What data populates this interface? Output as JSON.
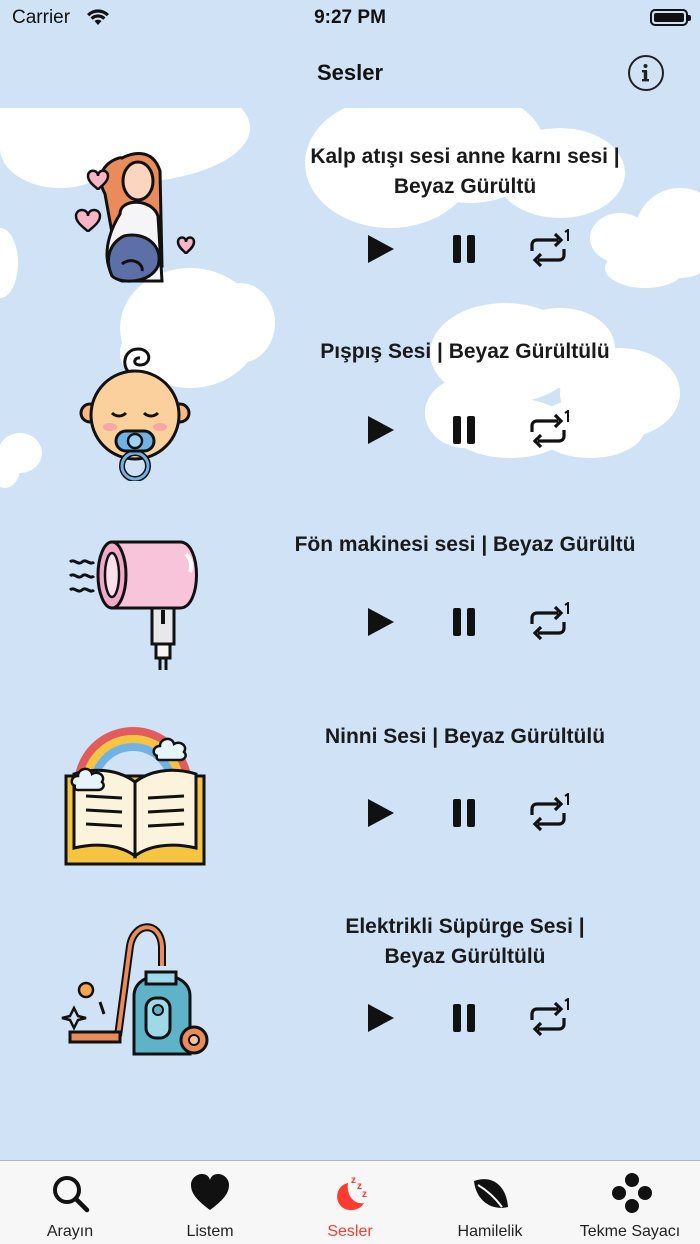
{
  "status_bar": {
    "carrier": "Carrier",
    "time": "9:27 PM"
  },
  "nav": {
    "title": "Sesler",
    "info_icon": "info-circle-icon"
  },
  "sounds": [
    {
      "title_line1": "Kalp atışı sesi anne karnı sesi |",
      "title_line2": "Beyaz Gürültü",
      "icon": "pregnant-woman-icon"
    },
    {
      "title_line1": "Pışpış Sesi | Beyaz Gürültülü",
      "title_line2": "",
      "icon": "baby-pacifier-icon"
    },
    {
      "title_line1": "Fön makinesi sesi | Beyaz Gürültü",
      "title_line2": "",
      "icon": "hair-dryer-icon"
    },
    {
      "title_line1": "Ninni Sesi | Beyaz Gürültülü",
      "title_line2": "",
      "icon": "storybook-rainbow-icon"
    },
    {
      "title_line1": "Elektrikli Süpürge Sesi |",
      "title_line2": "Beyaz Gürültülü",
      "icon": "vacuum-cleaner-icon"
    }
  ],
  "tabs": [
    {
      "label": "Arayın",
      "icon": "search-icon"
    },
    {
      "label": "Listem",
      "icon": "heart-icon"
    },
    {
      "label": "Sesler",
      "icon": "moon-zzz-icon",
      "active": true
    },
    {
      "label": "Hamilelik",
      "icon": "leaf-icon"
    },
    {
      "label": "Tekme Sayacı",
      "icon": "footprint-dots-icon"
    }
  ],
  "colors": {
    "background": "#cfe2f6",
    "active_tab": "#ff3b30",
    "tab_bar": "#f7f7f7"
  }
}
